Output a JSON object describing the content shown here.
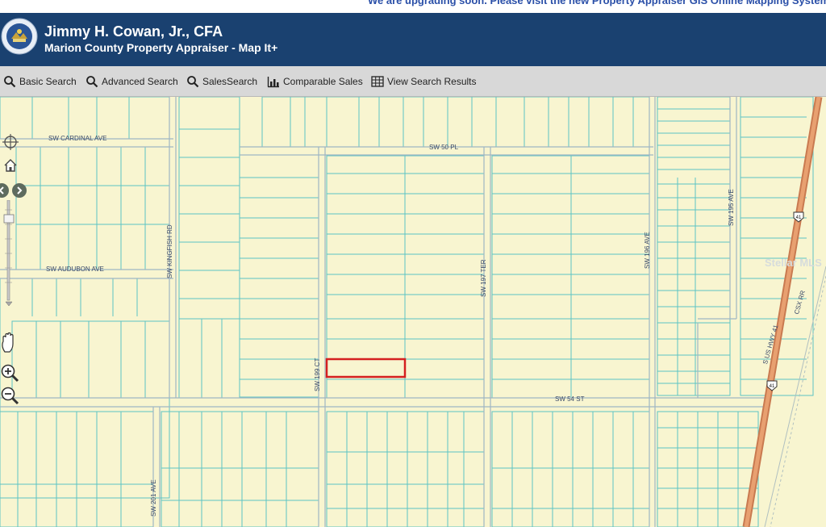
{
  "notice": {
    "text": "We are upgrading soon. Please visit the new Property Appraiser GIS Online Mapping System, click h"
  },
  "header": {
    "title": "Jimmy H. Cowan, Jr., CFA",
    "subtitle": "Marion County Property Appraiser - Map It+",
    "logo_icon": "county-seal-icon",
    "colors": {
      "header_bg": "#1a4170",
      "parcel_line": "#5cc4c4",
      "highlight": "#d42020",
      "map_bg": "#f8f5d0",
      "highway": "#d98a5a"
    }
  },
  "toolbar": {
    "items": [
      {
        "label": "Basic Search",
        "icon": "magnifier-icon"
      },
      {
        "label": "Advanced Search",
        "icon": "magnifier-icon"
      },
      {
        "label": "SalesSearch",
        "icon": "magnifier-icon"
      },
      {
        "label": "Comparable Sales",
        "icon": "bar-chart-icon"
      },
      {
        "label": "View Search Results",
        "icon": "grid-icon"
      }
    ]
  },
  "map": {
    "streets": {
      "sw_cardinal": "SW CARDINAL AVE",
      "sw_50_pl": "SW 50 PL",
      "sw_audubon": "SW AUDUBON AVE",
      "sw_kingfish": "SW KINGFISH RD",
      "sw_199_ct": "SW 199 CT",
      "sw_197_ter": "SW 197 TER",
      "sw_196_ave": "SW 196 AVE",
      "sw_195_ave": "SW 195 AVE",
      "sw_54_st": "SW 54 ST",
      "sw_201_ave": "SW 201 AVE",
      "us_hwy_41": "S US HWY 41",
      "csx_rr": "CSX RR",
      "shield_top": "41",
      "shield_bottom": "41"
    },
    "watermark": "Stellar MLS"
  }
}
